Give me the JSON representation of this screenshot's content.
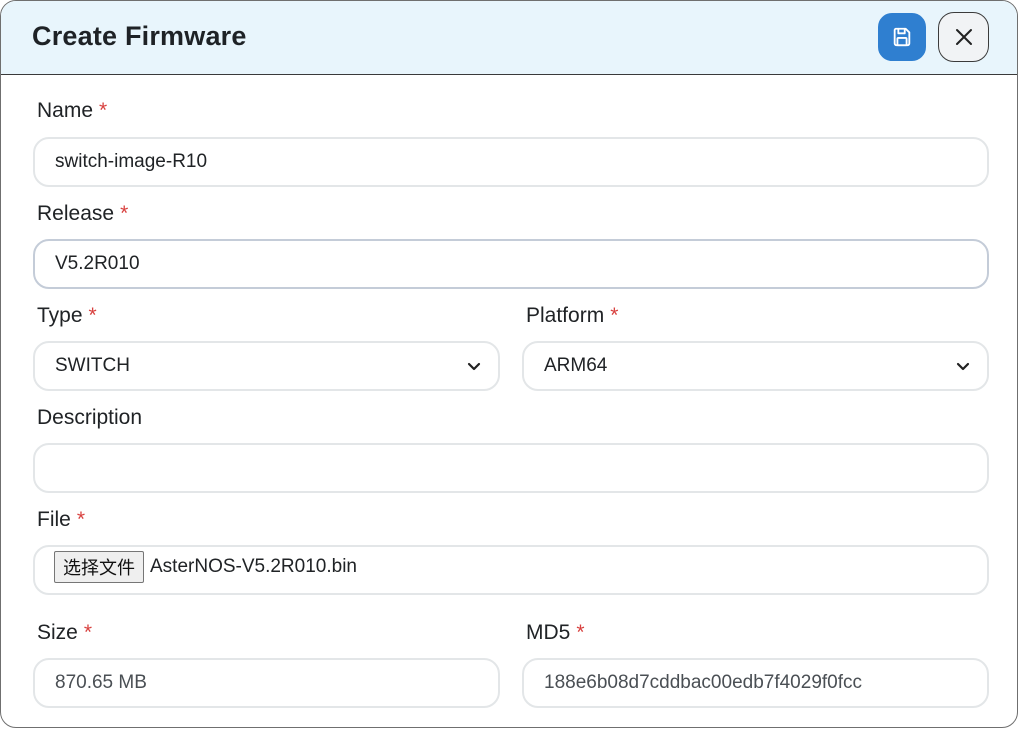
{
  "dialog": {
    "title": "Create Firmware",
    "save_icon": "floppy-disk-icon",
    "close_icon": "close-icon"
  },
  "required_marker": "*",
  "fields": {
    "name": {
      "label": "Name",
      "value": "switch-image-R10"
    },
    "release": {
      "label": "Release",
      "value": "V5.2R010"
    },
    "type": {
      "label": "Type",
      "value": "SWITCH"
    },
    "platform": {
      "label": "Platform",
      "value": "ARM64"
    },
    "description": {
      "label": "Description",
      "value": ""
    },
    "file": {
      "label": "File",
      "button_label": "选择文件",
      "file_name": "AsterNOS-V5.2R010.bin"
    },
    "size": {
      "label": "Size",
      "value": "870.65 MB"
    },
    "md5": {
      "label": "MD5",
      "value": "188e6b08d7cddbac00edb7f4029f0fcc"
    }
  },
  "colors": {
    "primary": "#2f7fd0",
    "header_bg": "#e8f5fc",
    "required": "#d8413f"
  }
}
